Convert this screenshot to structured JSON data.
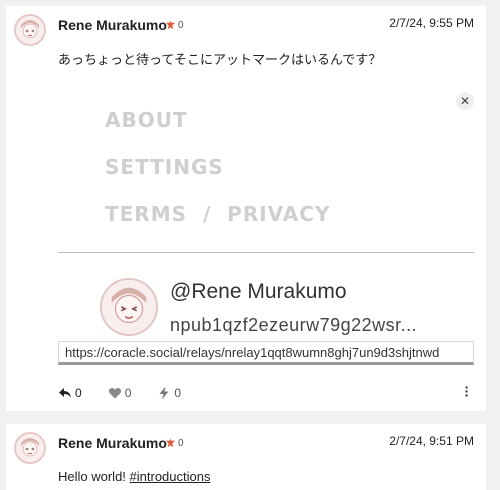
{
  "posts": [
    {
      "author": "Rene Murakumo",
      "zap_count": "0",
      "timestamp": "2/7/24, 9:55 PM",
      "text": "あっちょっと待ってそこにアットマークはいるんです？",
      "preview": {
        "close_glyph": "✕",
        "menu": [
          "ABOUT",
          "SETTINGS",
          "TERMS  /  PRIVACY"
        ],
        "handle": "@Rene Murakumo",
        "npub": "npub1qzf2ezeurw79g22wsr...",
        "url": "https://coracle.social/relays/nrelay1qqt8wumn8ghj7un9d3shjtnwd"
      },
      "actions": {
        "reply_count": "0",
        "like_count": "0",
        "zap_count": "0"
      },
      "icons": {
        "reply": "reply-icon",
        "like": "heart-icon",
        "zap": "zap-icon",
        "more": "more-vertical-icon"
      }
    },
    {
      "author": "Rene Murakumo",
      "zap_count": "0",
      "timestamp": "2/7/24, 9:51 PM",
      "text_prefix": "Hello world! ",
      "hashtag": "#introductions"
    }
  ],
  "colors": {
    "accent": "#e05c3a",
    "muted": "#cfcfcf",
    "card": "#ffffff",
    "background": "#f1f1f1"
  }
}
